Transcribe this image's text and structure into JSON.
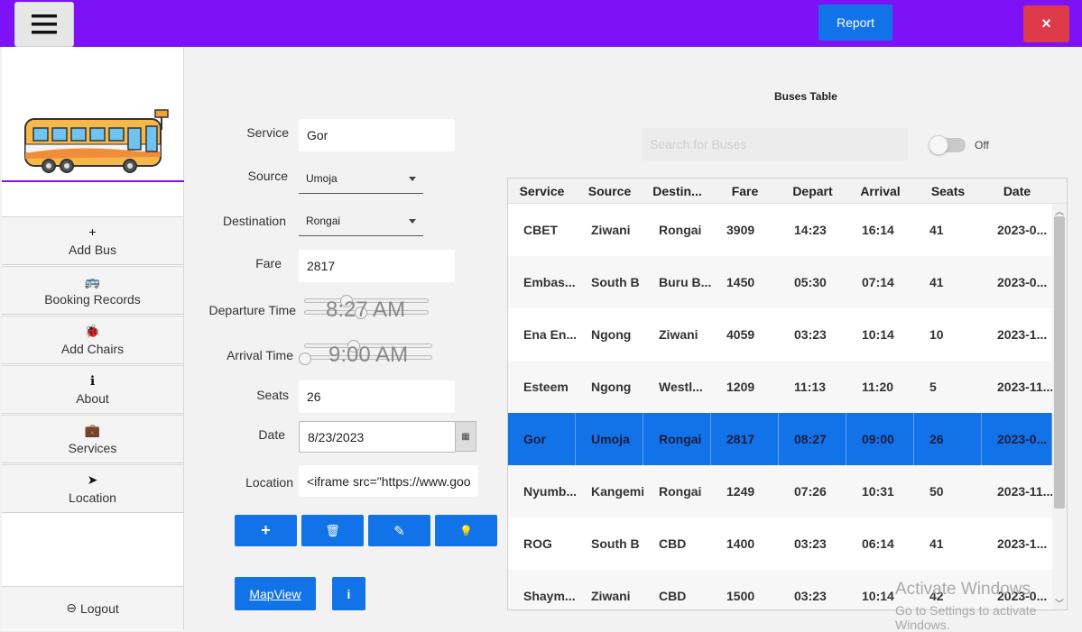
{
  "topbar": {
    "report_label": "Report",
    "close_label": "×",
    "accent": "#7c12f5",
    "button_color": "#1273e8",
    "close_color": "#de3a4a"
  },
  "sidebar": {
    "items": [
      {
        "icon": "plus-icon",
        "glyph": "+",
        "label": "Add Bus"
      },
      {
        "icon": "bus-icon",
        "glyph": "🚌",
        "label": "Booking Records"
      },
      {
        "icon": "bug-icon",
        "glyph": "🐞",
        "label": "Add Chairs"
      },
      {
        "icon": "info-circle-icon",
        "glyph": "ℹ",
        "label": "About"
      },
      {
        "icon": "briefcase-icon",
        "glyph": "💼",
        "label": "Services"
      },
      {
        "icon": "location-arrow-icon",
        "glyph": "➤",
        "label": "Location"
      }
    ],
    "logout_glyph": "⊖",
    "logout_label": "Logout"
  },
  "form": {
    "service_label": "Service",
    "service_value": "Gor",
    "source_label": "Source",
    "source_value": "Umoja",
    "destination_label": "Destination",
    "destination_value": "Rongai",
    "fare_label": "Fare",
    "fare_value": "2817",
    "departure_label": "Departure Time",
    "departure_value": "8:27 AM",
    "arrival_label": "Arrival Time",
    "arrival_value": "9:00 AM",
    "seats_label": "Seats",
    "seats_value": "26",
    "date_label": "Date",
    "date_value": "8/23/2023",
    "location_label": "Location",
    "location_value": "<iframe src=\"https://www.goo",
    "add_glyph": "+",
    "delete_glyph": "🗑",
    "edit_glyph": "✎",
    "idea_glyph": "💡",
    "mapview_label": "MapView",
    "info_glyph": "i"
  },
  "table": {
    "title": "Buses Table",
    "search_placeholder": "Search for Buses",
    "toggle_label": "Off",
    "columns": [
      "Service",
      "Source",
      "Destin...",
      "Fare",
      "Depart",
      "Arrival",
      "Seats",
      "Date"
    ],
    "rows": [
      [
        "CBET",
        "Ziwani",
        "Rongai",
        "3909",
        "14:23",
        "16:14",
        "41",
        "2023-0..."
      ],
      [
        "Embas...",
        "South B",
        "Buru B...",
        "1450",
        "05:30",
        "07:14",
        "41",
        "2023-0..."
      ],
      [
        "Ena En...",
        "Ngong",
        "Ziwani",
        "4059",
        "03:23",
        "10:14",
        "10",
        "2023-1..."
      ],
      [
        "Esteem",
        "Ngong",
        "Westl...",
        "1209",
        "11:13",
        "11:20",
        "5",
        "2023-11..."
      ],
      [
        "Gor",
        "Umoja",
        "Rongai",
        "2817",
        "08:27",
        "09:00",
        "26",
        "2023-0..."
      ],
      [
        "Nyumb...",
        "Kangemi",
        "Rongai",
        "1249",
        "07:26",
        "10:31",
        "50",
        "2023-11..."
      ],
      [
        "ROG",
        "South B",
        "CBD",
        "1400",
        "03:23",
        "06:14",
        "41",
        "2023-1..."
      ],
      [
        "Shaym...",
        "Ziwani",
        "CBD",
        "1500",
        "03:23",
        "10:14",
        "42",
        "2023-0..."
      ]
    ],
    "selected_row": 4
  },
  "watermark": {
    "line1": "Activate Windows",
    "line2": "Go to Settings to activate Windows."
  }
}
